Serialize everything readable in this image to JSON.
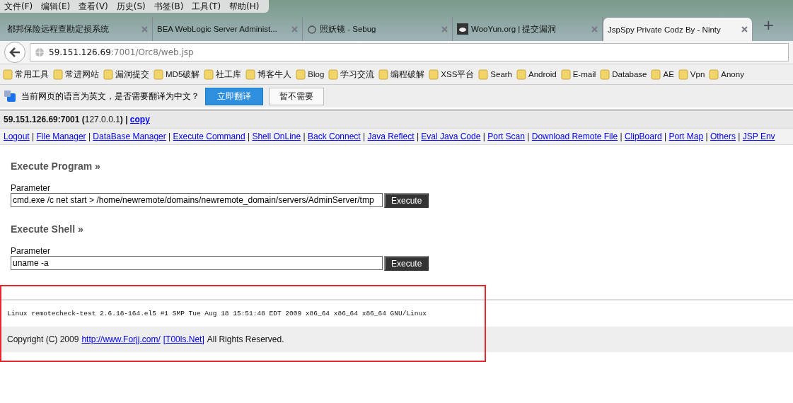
{
  "menu_bar": [
    "文件(F)",
    "编辑(E)",
    "查看(V)",
    "历史(S)",
    "书签(B)",
    "工具(T)",
    "帮助(H)"
  ],
  "tabs": [
    {
      "title": "都邦保险远程查勘定损系统",
      "selected": false
    },
    {
      "title": "BEA WebLogic Server Administ...",
      "selected": false
    },
    {
      "title": "照妖镜 - Sebug",
      "selected": false
    },
    {
      "title": "WooYun.org | 提交漏洞",
      "selected": false
    },
    {
      "title": "JspSpy Private Codz By - Ninty",
      "selected": true
    }
  ],
  "new_tab": "+",
  "address": {
    "host": "59.151.126.69",
    "path": ":7001/Orc8/web.jsp"
  },
  "bookmarks": [
    "常用工具",
    "常进网站",
    "漏洞提交",
    "MD5破解",
    "社工库",
    "博客牛人",
    "Blog",
    "学习交流",
    "编程破解",
    "XSS平台",
    "Searh",
    "Android",
    "E-mail",
    "Database",
    "AE",
    "Vpn",
    "Anony"
  ],
  "translate_bar": {
    "message": "当前网页的语言为英文，是否需要翻译为中文？",
    "buttons": [
      "立即翻译",
      "暂不需要"
    ]
  },
  "page": {
    "server_info": "**59.151.126.69:7001 (**127.0.0.1**) |**",
    "copy_link": "copy",
    "nav_separators": [
      "|",
      "|",
      "|",
      "|",
      "|",
      "|",
      "|",
      "|",
      "|",
      "|",
      "|",
      "|",
      "|"
    ],
    "nav_links": [
      "Logout",
      "File Manager",
      "DataBase Manager",
      "Execute Command",
      "Shell OnLine",
      "Back Connect",
      "Java Reflect",
      "Eval Java Code",
      "Port Scan",
      "Download Remote File",
      "ClipBoard",
      "Port Map",
      "Others",
      "JSP Env"
    ],
    "sections": [
      {
        "title": "Execute Program »",
        "label": "Parameter",
        "value": "cmd.exe /c net start > /home/newremote/domains/newremote_domain/servers/AdminServer/tmp",
        "button": "Execute"
      },
      {
        "title": "Execute Shell »",
        "label": "Parameter",
        "value": "uname -a",
        "button": "Execute"
      }
    ],
    "output": "Linux remotecheck-test 2.6.18-164.el5 #1 SMP Tue Aug 18 15:51:48 EDT 2009 x86_64 x86_64 x86_64 GNU/Linux",
    "footer": {
      "text_before": "Copyright (C) 2009",
      "link_1": "http://www.Forjj.com/",
      "link_2": "[T00ls.Net]",
      "text_after": "All Rights Reserved."
    }
  }
}
